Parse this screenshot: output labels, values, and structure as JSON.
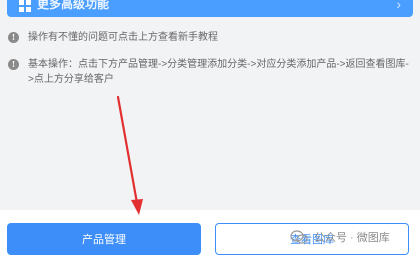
{
  "top_bar": {
    "title": "更多高级功能",
    "icon": "grid-icon"
  },
  "notes": [
    {
      "text": "操作有不懂的问题可点击上方查看新手教程"
    },
    {
      "text": "基本操作：点击下方产品管理->分类管理添加分类->对应分类添加产品->返回查看图库->点上方分享给客户"
    }
  ],
  "buttons": {
    "primary": "产品管理",
    "secondary": "查看图库"
  },
  "watermark": {
    "text": "公众号 · 微图库"
  },
  "colors": {
    "accent": "#3d8ef8",
    "annotation_arrow": "#e23030"
  }
}
